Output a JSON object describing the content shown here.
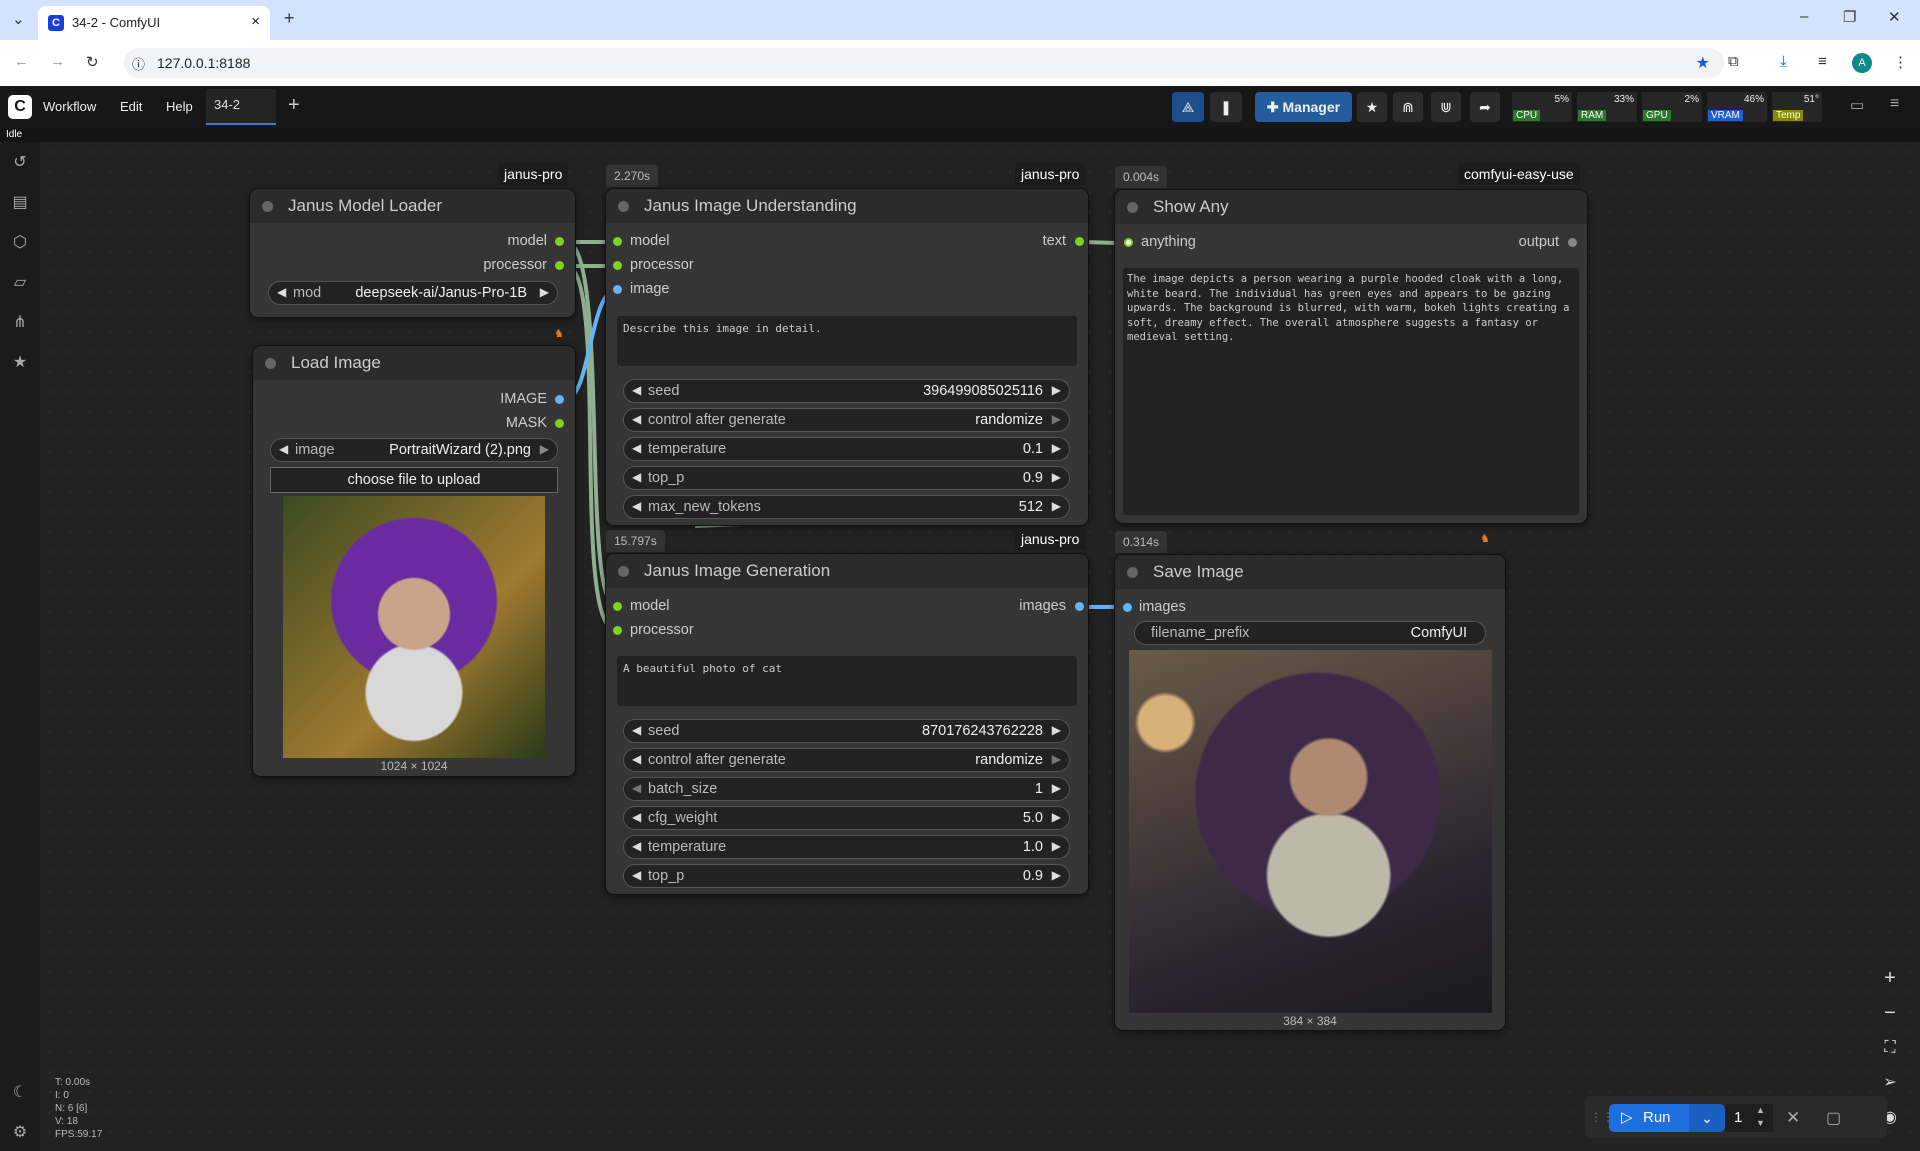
{
  "browser": {
    "tab_title": "34-2 - ComfyUI",
    "url": "127.0.0.1:8188"
  },
  "topbar": {
    "menu": [
      "Workflow",
      "Edit",
      "Help"
    ],
    "workflow_tab": "34-2",
    "manager_label": "Manager",
    "status": "Idle",
    "monitors": [
      {
        "label": "CPU",
        "value": "5%",
        "color": "#2a7a2a"
      },
      {
        "label": "RAM",
        "value": "33%",
        "color": "#2a7a2a"
      },
      {
        "label": "GPU",
        "value": "2%",
        "color": "#2a7a2a"
      },
      {
        "label": "VRAM",
        "value": "46%",
        "color": "#1f5fd0"
      },
      {
        "label": "Temp",
        "value": "51°",
        "color": "#8a8a00"
      }
    ]
  },
  "nodes": {
    "janus_loader": {
      "title": "Janus Model Loader",
      "badge": "janus-pro",
      "outputs": [
        "model",
        "processor"
      ],
      "widget_label": "mod",
      "widget_value": "deepseek-ai/Janus-Pro-1B"
    },
    "load_image": {
      "title": "Load Image",
      "outputs": [
        "IMAGE",
        "MASK"
      ],
      "image_label": "image",
      "image_value": "PortraitWizard (2).png",
      "upload_label": "choose file to upload",
      "dims": "1024 × 1024"
    },
    "understanding": {
      "title": "Janus Image Understanding",
      "badge": "janus-pro",
      "timer": "2.270s",
      "inputs": [
        "model",
        "processor",
        "image"
      ],
      "output": "text",
      "prompt": "Describe this image in detail.",
      "widgets": [
        {
          "name": "seed",
          "value": "396499085025116"
        },
        {
          "name": "control after generate",
          "value": "randomize"
        },
        {
          "name": "temperature",
          "value": "0.1"
        },
        {
          "name": "top_p",
          "value": "0.9"
        },
        {
          "name": "max_new_tokens",
          "value": "512"
        }
      ]
    },
    "show_any": {
      "title": "Show Any",
      "badge": "comfyui-easy-use",
      "timer": "0.004s",
      "input": "anything",
      "output": "output",
      "text": "The image depicts a person wearing a purple hooded cloak with a long, white beard. The individual has green eyes and appears to be gazing upwards. The background is blurred, with warm, bokeh lights creating a soft, dreamy effect. The overall atmosphere suggests a fantasy or medieval setting."
    },
    "generation": {
      "title": "Janus Image Generation",
      "badge": "janus-pro",
      "timer": "15.797s",
      "inputs": [
        "model",
        "processor"
      ],
      "output": "images",
      "prompt": "A beautiful photo of cat",
      "widgets": [
        {
          "name": "seed",
          "value": "870176243762228"
        },
        {
          "name": "control after generate",
          "value": "randomize"
        },
        {
          "name": "batch_size",
          "value": "1"
        },
        {
          "name": "cfg_weight",
          "value": "5.0"
        },
        {
          "name": "temperature",
          "value": "1.0"
        },
        {
          "name": "top_p",
          "value": "0.9"
        }
      ]
    },
    "save_image": {
      "title": "Save Image",
      "timer": "0.314s",
      "input": "images",
      "prefix_label": "filename_prefix",
      "prefix_value": "ComfyUI",
      "dims": "384 × 384"
    }
  },
  "run": {
    "label": "Run",
    "count": "1"
  },
  "perf": [
    "T: 0.00s",
    "I: 0",
    "N: 6 [6]",
    "V: 18",
    "FPS:59.17"
  ]
}
